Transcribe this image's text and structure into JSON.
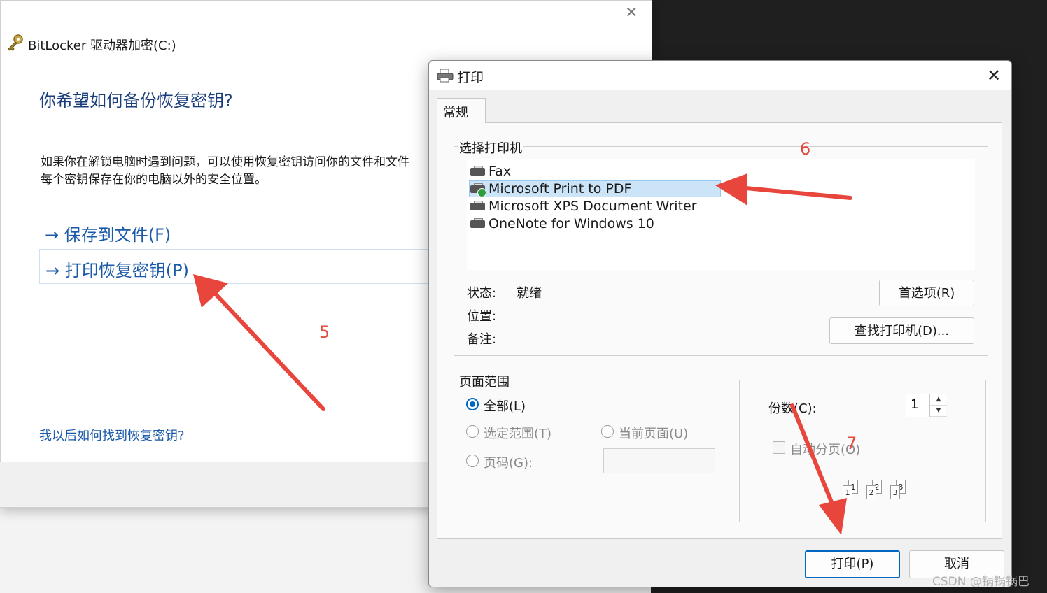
{
  "bitlocker": {
    "title": "BitLocker 驱动器加密(C:)",
    "heading": "你希望如何备份恢复密钥?",
    "description_line1": "如果你在解锁电脑时遇到问题，可以使用恢复密钥访问你的文件和文件",
    "description_line2": "每个密钥保存在你的电脑以外的安全位置。",
    "options": [
      {
        "label": "→ 保存到文件(F)"
      },
      {
        "label": "→ 打印恢复密钥(P)"
      }
    ],
    "help_link": "我以后如何找到恢复密钥?",
    "close_glyph": "✕"
  },
  "print_dialog": {
    "title": "打印",
    "close_glyph": "✕",
    "tab": "常规",
    "select_printer_label": "选择打印机",
    "printers": [
      {
        "name": "Fax",
        "selected": false,
        "default": false
      },
      {
        "name": "Microsoft Print to PDF",
        "selected": true,
        "default": true
      },
      {
        "name": "Microsoft XPS Document Writer",
        "selected": false,
        "default": false
      },
      {
        "name": "OneNote for Windows 10",
        "selected": false,
        "default": false
      }
    ],
    "status_label": "状态:",
    "status_value": "就绪",
    "location_label": "位置:",
    "comment_label": "备注:",
    "preferences_button": "首选项(R)",
    "find_printer_button": "查找打印机(D)...",
    "page_range_label": "页面范围",
    "range_all": "全部(L)",
    "range_selection": "选定范围(T)",
    "range_current": "当前页面(U)",
    "range_pages": "页码(G):",
    "copies_label": "份数(C):",
    "copies_value": "1",
    "collate_label": "自动分页(O)",
    "collate_pages": [
      "1",
      "1",
      "2",
      "2",
      "3",
      "3"
    ],
    "print_button": "打印(P)",
    "cancel_button": "取消"
  },
  "annotations": {
    "step5": "5",
    "step6": "6",
    "step7": "7",
    "arrow_color": "#e8463c"
  },
  "watermark": "CSDN @锅锅锅巴",
  "colors": {
    "link_blue": "#1a5aa8",
    "heading_blue": "#1a3d7c",
    "accent": "#0067c0",
    "selection": "#cce4f7"
  }
}
